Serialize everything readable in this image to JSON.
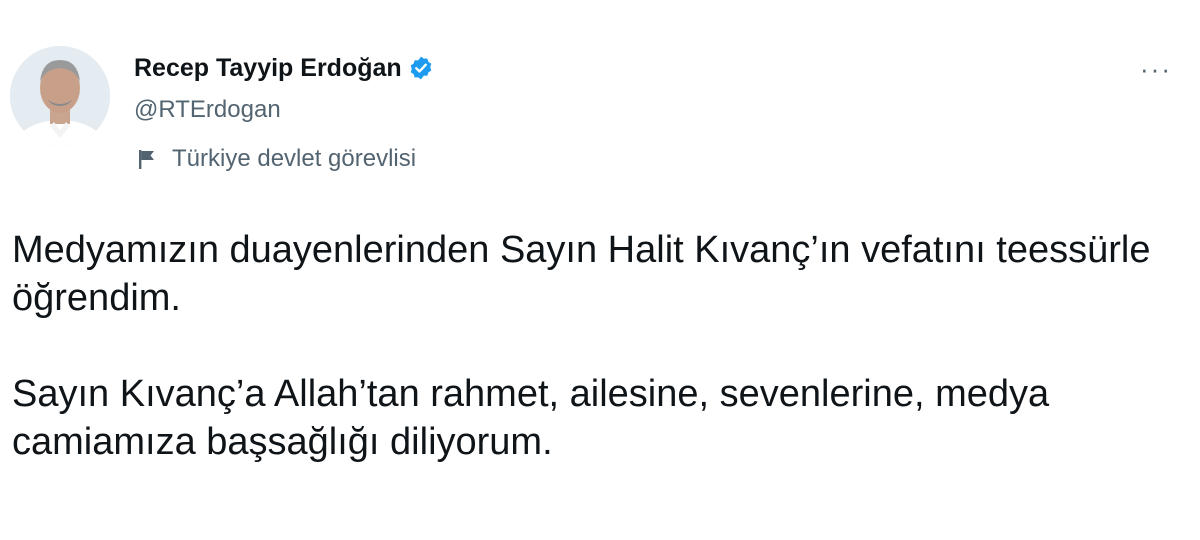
{
  "author": {
    "display_name": "Recep Tayyip Erdoğan",
    "handle": "@RTErdogan",
    "verified": true,
    "label": "Türkiye devlet görevlisi",
    "label_icon": "flag-icon",
    "avatar_icon": "profile-photo"
  },
  "actions": {
    "more_label": "···"
  },
  "tweet": {
    "paragraphs": [
      "Medyamızın duayenlerinden Sayın Halit Kıvanç’ın vefatını teessürle öğrendim.",
      "Sayın Kıvanç’a Allah’tan rahmet, ailesine, sevenlerine, medya camiamıza başsağlığı diliyorum."
    ]
  },
  "colors": {
    "text_primary": "#0f1419",
    "text_secondary": "#536471",
    "verified_blue": "#1d9bf0",
    "background": "#ffffff"
  }
}
